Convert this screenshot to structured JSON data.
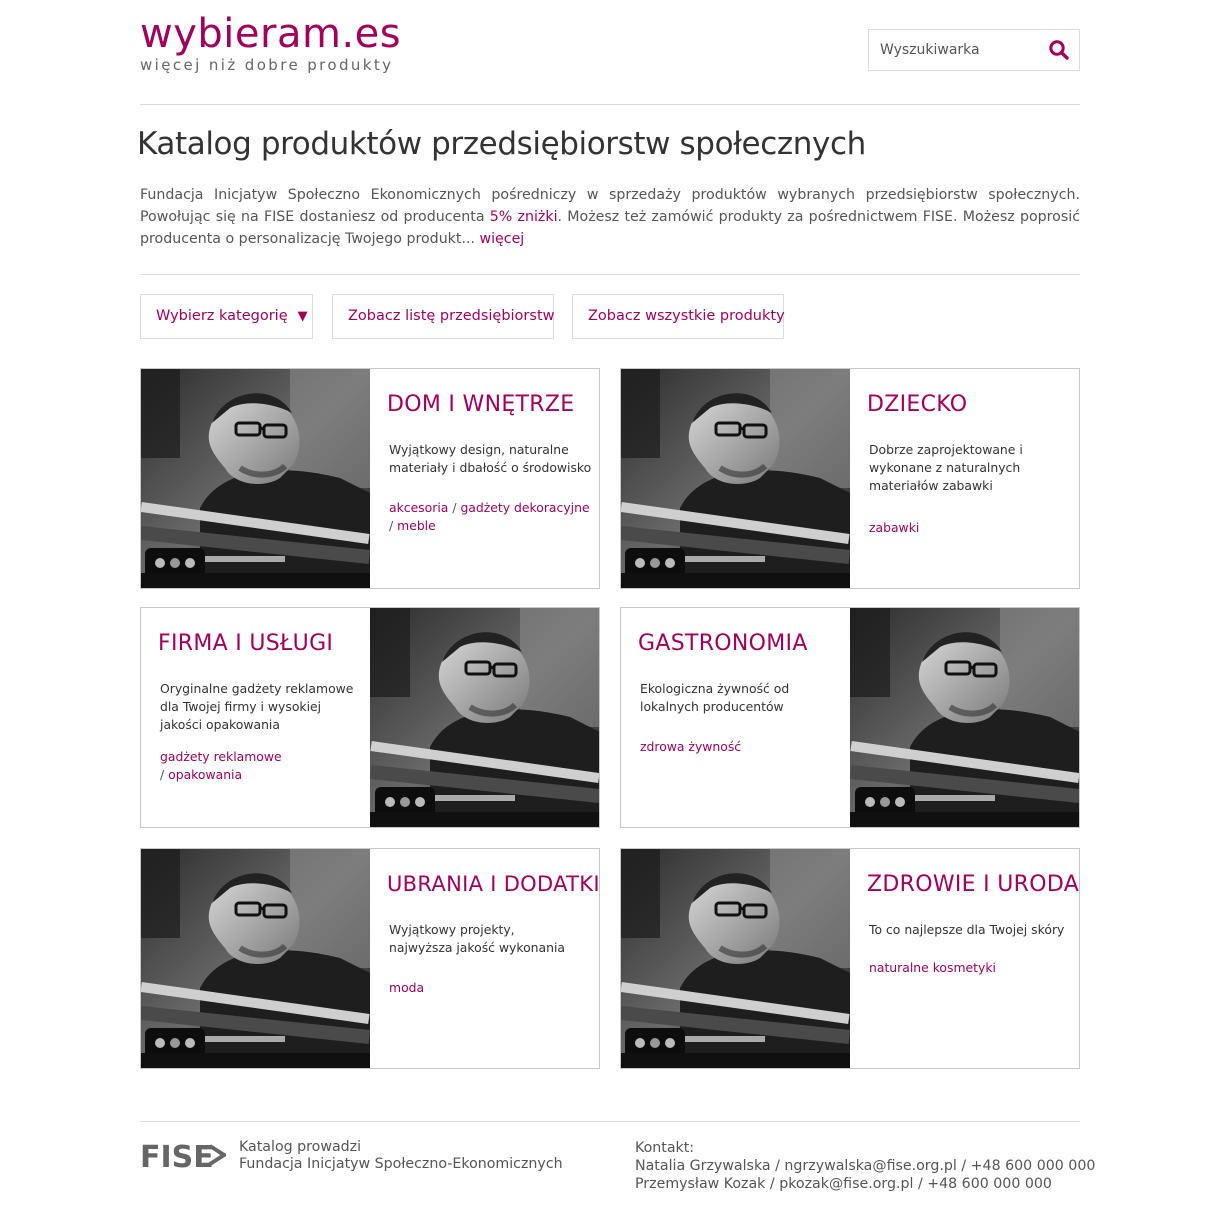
{
  "header": {
    "logo_main": "wybieram.es",
    "logo_tagline": "więcej niż dobre produkty",
    "search_placeholder": "Wyszukiwarka"
  },
  "main": {
    "title": "Katalog produktów przedsiębiorstw społecznych",
    "intro_part1": "Fundacja Inicjatyw Społeczno Ekonomicznych pośredniczy w sprzedaży produktów wybranych przedsiębiorstw społecznych. Powołując się na FISE dostaniesz od producenta ",
    "intro_highlight": "5% zniżki",
    "intro_part2": ". Możesz też zamówić produkty za pośrednictwem FISE. Możesz poprosić producenta o personalizację Twojego produkt... ",
    "intro_more": "więcej"
  },
  "toolbar": {
    "category_label": "Wybierz kategorię",
    "category_arrow": "▼",
    "companies_label": "Zobacz listę przedsiębiorstw",
    "all_products_label": "Zobacz wszystkie produkty"
  },
  "categories": [
    {
      "title": "DOM I WNĘTRZE",
      "desc": "Wyjątkowy design, naturalne materiały i dbałość o środowisko",
      "links": [
        "akcesoria",
        "gadżety dekoracyjne",
        "meble"
      ]
    },
    {
      "title": "DZIECKO",
      "desc": "Dobrze zaprojektowane i wykonane z naturalnych materiałów zabawki",
      "links": [
        "zabawki"
      ]
    },
    {
      "title": "FIRMA I USŁUGI",
      "desc": "Oryginalne gadżety reklamowe dla Twojej firmy i wysokiej jakości opakowania",
      "links": [
        "gadżety reklamowe",
        "opakowania"
      ]
    },
    {
      "title": "GASTRONOMIA",
      "desc": "Ekologiczna żywność od lokalnych producentów",
      "links": [
        "zdrowa żywność"
      ]
    },
    {
      "title": "UBRANIA I DODATKI",
      "desc": "Wyjątkowy projekty, najwyższa jakość wykonania",
      "links": [
        "moda"
      ]
    },
    {
      "title": "ZDROWIE I URODA",
      "desc": "To co najlepsze dla Twojej skóry",
      "links": [
        "naturalne kosmetyki"
      ]
    }
  ],
  "link_separator": " / ",
  "footer": {
    "logo_text": "FISE",
    "org_line1": "Katalog prowadzi",
    "org_line2": "Fundacja Inicjatyw Społeczno-Ekonomicznych",
    "contact_label": "Kontakt:",
    "contact1": "Natalia Grzywalska / ngrzywalska@fise.org.pl / +48 600 000 000",
    "contact2": "Przemysław Kozak / pkozak@fise.org.pl / +48 600 000 000"
  },
  "colors": {
    "accent": "#a3005e",
    "border": "#dcdcdc",
    "text": "#555555"
  },
  "icons": {
    "search": "search-icon",
    "photo": "craftsman-photo"
  }
}
